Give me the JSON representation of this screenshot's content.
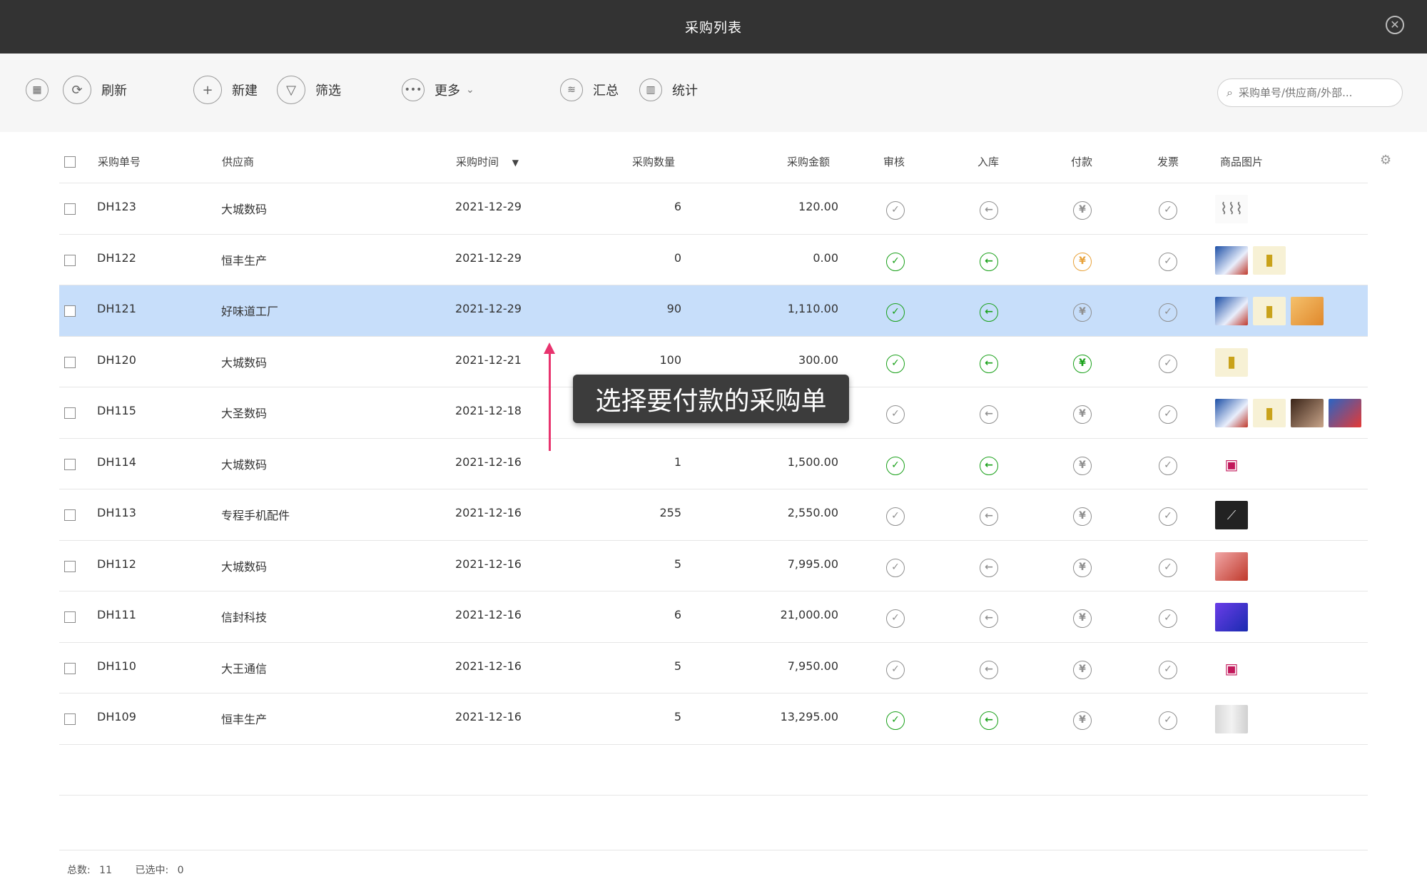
{
  "window": {
    "title": "采购列表"
  },
  "toolbar": {
    "refresh": "刷新",
    "new": "新建",
    "filter": "筛选",
    "more": "更多",
    "summary": "汇总",
    "stats": "统计",
    "search_placeholder": "采购单号/供应商/外部..."
  },
  "table": {
    "headers": {
      "order_no": "采购单号",
      "supplier": "供应商",
      "time": "采购时间",
      "sort_mark": "▼",
      "qty": "采购数量",
      "amount": "采购金额",
      "audit": "审核",
      "stock_in": "入库",
      "payment": "付款",
      "invoice": "发票",
      "images": "商品图片"
    },
    "rows": [
      {
        "order_no": "DH123",
        "supplier": "大城数码",
        "time": "2021-12-29",
        "qty": "6",
        "amount": "120.00",
        "audit": "grey",
        "stock_in": "grey",
        "payment": "grey",
        "invoice": "grey",
        "thumbs": [
          "cables"
        ]
      },
      {
        "order_no": "DH122",
        "supplier": "恒丰生产",
        "time": "2021-12-29",
        "qty": "0",
        "amount": "0.00",
        "audit": "green",
        "stock_in": "green",
        "payment": "orange",
        "invoice": "grey",
        "thumbs": [
          "box-blue",
          "icecream"
        ]
      },
      {
        "order_no": "DH121",
        "supplier": "好味道工厂",
        "time": "2021-12-29",
        "qty": "90",
        "amount": "1,110.00",
        "audit": "green",
        "stock_in": "green",
        "payment": "grey",
        "invoice": "grey",
        "thumbs": [
          "box-blue",
          "icecream",
          "food"
        ]
      },
      {
        "order_no": "DH120",
        "supplier": "大城数码",
        "time": "2021-12-21",
        "qty": "100",
        "amount": "300.00",
        "audit": "green",
        "stock_in": "green",
        "payment": "green",
        "invoice": "grey",
        "thumbs": [
          "icecream"
        ]
      },
      {
        "order_no": "DH115",
        "supplier": "大圣数码",
        "time": "2021-12-18",
        "qty": "",
        "amount": "",
        "audit": "grey",
        "stock_in": "grey",
        "payment": "grey",
        "invoice": "grey",
        "thumbs": [
          "box-blue",
          "icecream",
          "meat",
          "bag"
        ]
      },
      {
        "order_no": "DH114",
        "supplier": "大城数码",
        "time": "2021-12-16",
        "qty": "1",
        "amount": "1,500.00",
        "audit": "green",
        "stock_in": "green",
        "payment": "grey",
        "invoice": "grey",
        "thumbs": [
          "icon-pink"
        ]
      },
      {
        "order_no": "DH113",
        "supplier": "专程手机配件",
        "time": "2021-12-16",
        "qty": "255",
        "amount": "2,550.00",
        "audit": "grey",
        "stock_in": "grey",
        "payment": "grey",
        "invoice": "grey",
        "thumbs": [
          "cable-dark"
        ]
      },
      {
        "order_no": "DH112",
        "supplier": "大城数码",
        "time": "2021-12-16",
        "qty": "5",
        "amount": "7,995.00",
        "audit": "grey",
        "stock_in": "grey",
        "payment": "grey",
        "invoice": "grey",
        "thumbs": [
          "phone-red"
        ]
      },
      {
        "order_no": "DH111",
        "supplier": "信封科技",
        "time": "2021-12-16",
        "qty": "6",
        "amount": "21,000.00",
        "audit": "grey",
        "stock_in": "grey",
        "payment": "grey",
        "invoice": "grey",
        "thumbs": [
          "phone-blue"
        ]
      },
      {
        "order_no": "DH110",
        "supplier": "大王通信",
        "time": "2021-12-16",
        "qty": "5",
        "amount": "7,950.00",
        "audit": "grey",
        "stock_in": "grey",
        "payment": "grey",
        "invoice": "grey",
        "thumbs": [
          "icon-pink"
        ]
      },
      {
        "order_no": "DH109",
        "supplier": "恒丰生产",
        "time": "2021-12-16",
        "qty": "5",
        "amount": "13,295.00",
        "audit": "green",
        "stock_in": "green",
        "payment": "grey",
        "invoice": "grey",
        "thumbs": [
          "cabinet"
        ]
      }
    ]
  },
  "footer": {
    "total_label": "总数:",
    "total": "11",
    "selected_label": "已选中:",
    "selected": "0"
  },
  "annotation": {
    "text": "选择要付款的采购单"
  },
  "colors": {
    "green": "#1aa11a",
    "orange": "#e8a23a",
    "grey": "#8f8f8f",
    "selected_row": "#c7defa",
    "arrow": "#e8336e"
  },
  "icons": {
    "close": "close-icon",
    "refresh": "refresh-icon",
    "new": "plus-icon",
    "filter": "funnel-icon",
    "more": "ellipsis-icon",
    "summary": "layers-icon",
    "stats": "bar-chart-icon",
    "settings": "gear-icon"
  }
}
